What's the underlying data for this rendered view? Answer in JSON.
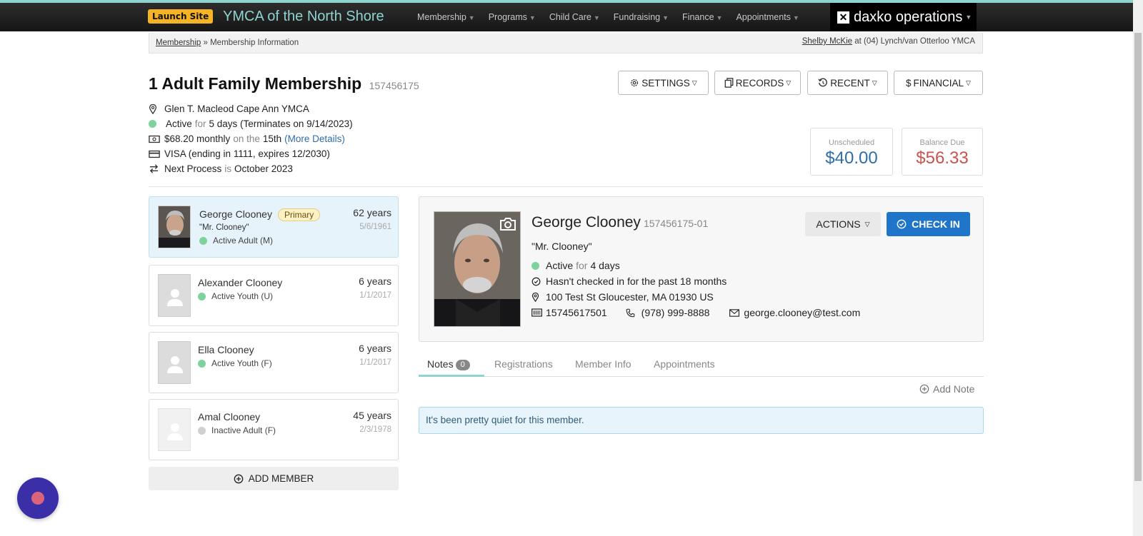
{
  "nav": {
    "launch_label": "Launch Site",
    "brand": "YMCA of the North Shore",
    "items": [
      "Membership",
      "Programs",
      "Child Care",
      "Fundraising",
      "Finance",
      "Appointments"
    ],
    "daxko_label": "daxko operations"
  },
  "breadcrumb": {
    "root": "Membership",
    "sep": "»",
    "current": "Membership Information",
    "user": "Shelby McKie",
    "at_text": "at (04) Lynch/van Otterloo YMCA"
  },
  "membership": {
    "title": "1 Adult Family Membership",
    "id": "157456175",
    "branch": "Glen T. Macleod Cape Ann YMCA",
    "status": "Active",
    "for_word": "for",
    "status_duration": "5 days (Terminates on 9/14/2023)",
    "amount": "$68.20 monthly",
    "on_the": "on the",
    "day": "15th",
    "more_details": "(More Details)",
    "card": "VISA (ending in 1111, expires 12/2030)",
    "next_process_label": "Next Process",
    "is_word": "is",
    "next_process_value": "October 2023"
  },
  "buttons": {
    "settings": "SETTINGS",
    "records": "RECORDS",
    "recent": "RECENT",
    "financial": "FINANCIAL"
  },
  "balances": {
    "unscheduled_label": "Unscheduled",
    "unscheduled_value": "$40.00",
    "balance_due_label": "Balance Due",
    "balance_due_value": "$56.33"
  },
  "members": [
    {
      "name": "George Clooney",
      "badge": "Primary",
      "nick": "\"Mr. Clooney\"",
      "status": "Active Adult (M)",
      "age": "62 years",
      "dob": "5/6/1961"
    },
    {
      "name": "Alexander Clooney",
      "status": "Active Youth (U)",
      "age": "6 years",
      "dob": "1/1/2017"
    },
    {
      "name": "Ella Clooney",
      "status": "Active Youth (F)",
      "age": "6 years",
      "dob": "1/1/2017"
    },
    {
      "name": "Amal Clooney",
      "status": "Inactive Adult (F)",
      "age": "45 years",
      "dob": "2/3/1978"
    }
  ],
  "add_member_label": "ADD MEMBER",
  "detail": {
    "name": "George Clooney",
    "member_id": "157456175-01",
    "nick": "\"Mr. Clooney\"",
    "status": "Active",
    "for_word": "for",
    "duration": "4 days",
    "checkin_note": "Hasn't checked in for the past 18 months",
    "address": "100 Test St Gloucester, MA 01930 US",
    "barcode": "15745617501",
    "phone": "(978) 999-8888",
    "email": "george.clooney@test.com",
    "actions_label": "ACTIONS",
    "checkin_label": "CHECK IN"
  },
  "tabs": {
    "notes": "Notes",
    "notes_count": "0",
    "registrations": "Registrations",
    "member_info": "Member Info",
    "appointments": "Appointments"
  },
  "add_note_label": "Add Note",
  "empty_message": "It's been pretty quiet for this member.",
  "colors": {
    "accent_teal": "#8fd3cf",
    "unscheduled_blue": "#2f6ea8",
    "balance_red": "#c9534f",
    "checkin_blue": "#1e75c9",
    "active_green": "#7dd39b"
  }
}
